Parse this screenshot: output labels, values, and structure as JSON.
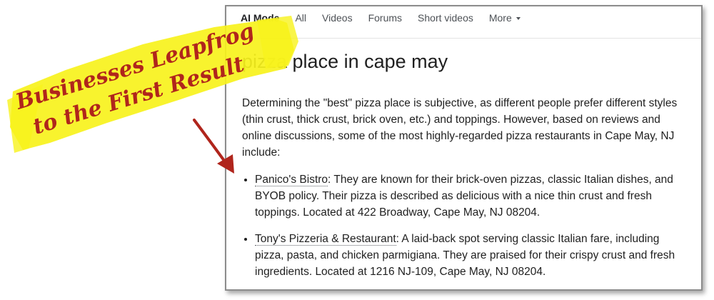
{
  "tabs": {
    "ai_mode": "AI Mode",
    "all": "All",
    "videos": "Videos",
    "forums": "Forums",
    "short_videos": "Short videos",
    "more": "More"
  },
  "query": {
    "visible_text": "pizza place in cape may"
  },
  "answer": {
    "intro": "Determining the \"best\" pizza place is subjective, as different people prefer different styles (thin crust, thick crust, brick oven, etc.) and toppings. However, based on reviews and online discussions, some of the most highly-regarded pizza restaurants in Cape May, NJ include:",
    "items": [
      {
        "name": "Panico's Bistro",
        "text": ": They are known for their brick-oven pizzas, classic Italian dishes, and BYOB policy. Their pizza is described as delicious with a nice thin crust and fresh toppings. Located at 422 Broadway, Cape May, NJ 08204."
      },
      {
        "name": "Tony's Pizzeria & Restaurant",
        "text": ": A laid-back spot serving classic Italian fare, including pizza, pasta, and chicken parmigiana. They are praised for their crispy crust and fresh ingredients. Located at 1216 NJ-109, Cape May, NJ 08204."
      }
    ]
  },
  "banner": {
    "line1": "Businesses Leapfrog",
    "line2": "to the First Result"
  },
  "colors": {
    "highlight": "#f7f21c",
    "ink": "#b0251c",
    "panel_border": "#8c8c8c",
    "text": "#1f1f1f",
    "tab_text": "#4d5156"
  },
  "icons": {
    "more_caret": "chevron-down-icon",
    "annotation_arrow": "arrow-down-icon"
  }
}
